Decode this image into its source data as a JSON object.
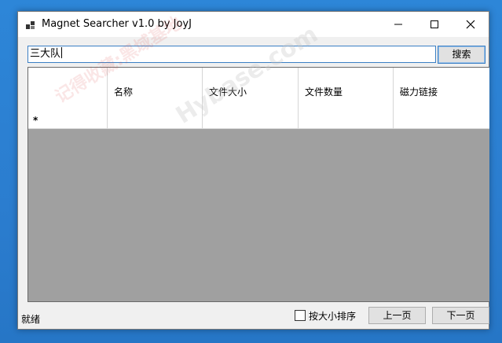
{
  "window": {
    "title": "Magnet Searcher v1.0 by JoyJ",
    "icon": "app-icon",
    "controls": [
      "minimize-icon",
      "maximize-icon",
      "close-icon"
    ]
  },
  "search": {
    "value": "三大队",
    "button_label": "搜索"
  },
  "table": {
    "columns": [
      "",
      "名称",
      "文件大小",
      "文件数量",
      "磁力链接"
    ],
    "new_row_marker": "*",
    "rows": []
  },
  "watermark": {
    "text_cn": "记得收藏:黑域基地",
    "text_en": "Hybase.com"
  },
  "status": {
    "text": "就绪",
    "sort_label": "按大小排序",
    "sort_checked": false,
    "prev_label": "上一页",
    "next_label": "下一页"
  },
  "colors": {
    "desktop": "#2a7fd0",
    "window_bg": "#f0f0f0",
    "grid_bg": "#a0a0a0",
    "accent_border": "#3b7fc4"
  }
}
